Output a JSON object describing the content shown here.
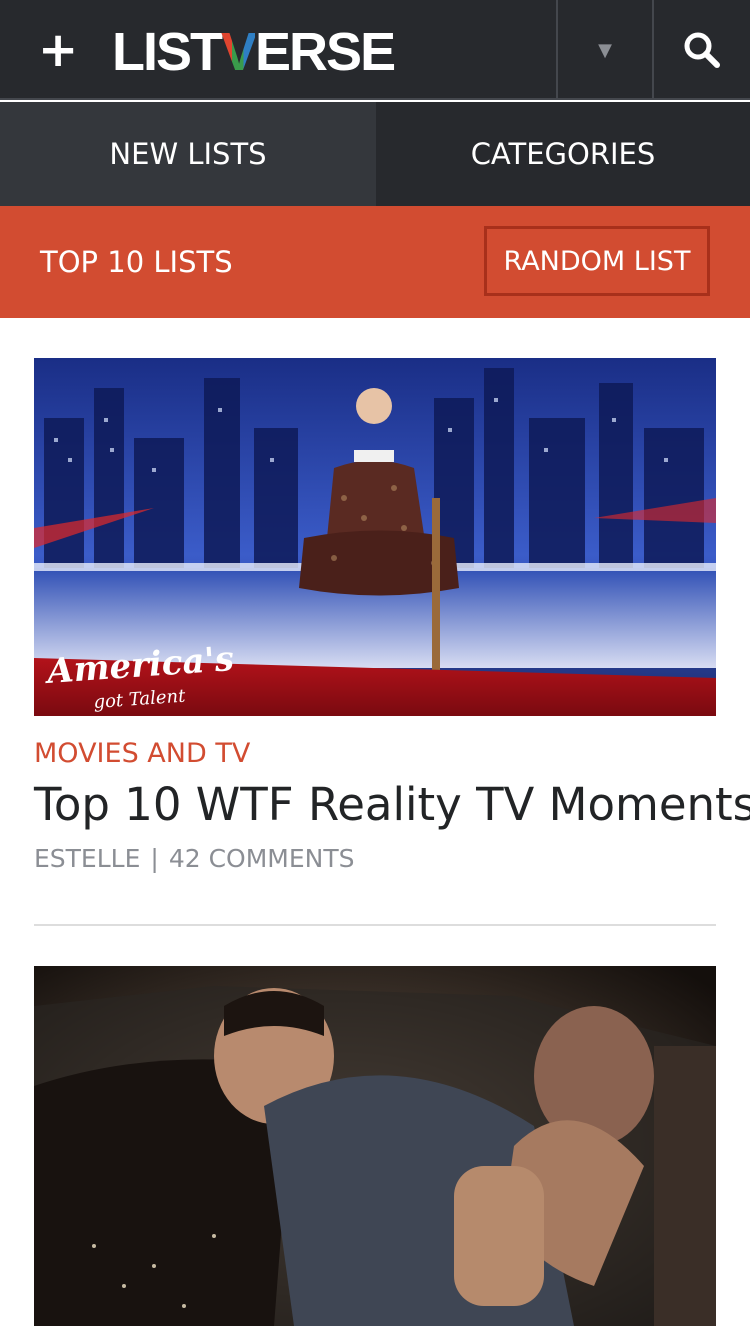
{
  "header": {
    "menu_icon": "plus-icon",
    "logo_prefix": "LIST",
    "logo_v": "V",
    "logo_suffix": "ERSE",
    "dropdown_icon": "chevron-down-icon",
    "search_icon": "search-icon"
  },
  "nav": {
    "tabs": [
      {
        "label": "NEW LISTS"
      },
      {
        "label": "CATEGORIES"
      }
    ]
  },
  "section": {
    "title": "TOP 10 LISTS",
    "random_label": "RANDOM LIST"
  },
  "articles": [
    {
      "category": "MOVIES AND TV",
      "title": "Top 10 WTF Reality TV Moments",
      "author": "ESTELLE",
      "separator": "|",
      "comments": "42 COMMENTS",
      "image_caption": "America's got Talent"
    }
  ],
  "colors": {
    "header_bg": "#27292d",
    "accent": "#d24c31",
    "text_dark": "#222426",
    "text_muted": "#8b8e94"
  }
}
